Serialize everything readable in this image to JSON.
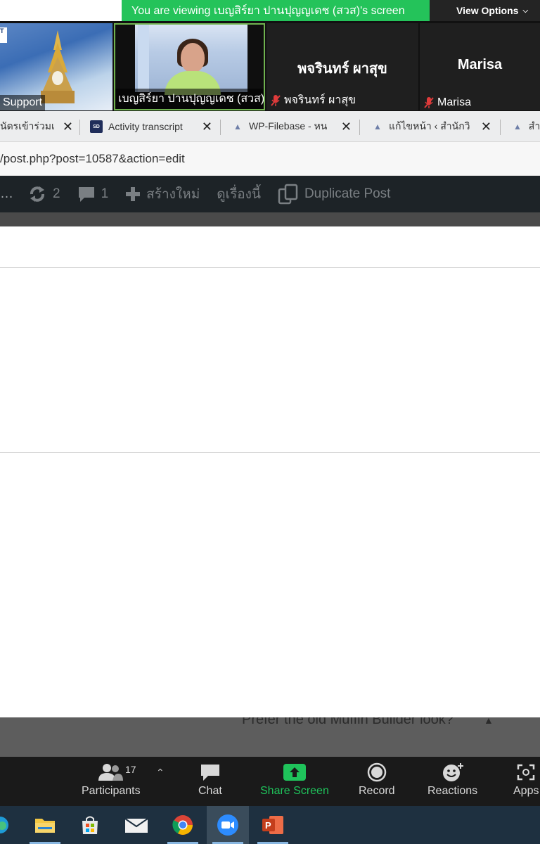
{
  "zoom": {
    "banner_text": "You are viewing เบญสิร์ยา ปานปุญญเดช (สวส)'s screen",
    "view_options": "View Options",
    "participants": [
      {
        "label": "Support"
      },
      {
        "label": "เบญสิร์ยา ปานปุญญเดช (สวส)"
      },
      {
        "name": "พจรินทร์ ผาสุข",
        "label": "พจรินทร์ ผาสุข"
      },
      {
        "name": "Marisa",
        "label": "Marisa"
      }
    ],
    "logo_fragment": "T",
    "controls": {
      "participants": "Participants",
      "participants_count": "17",
      "chat": "Chat",
      "share_screen": "Share Screen",
      "record": "Record",
      "reactions": "Reactions",
      "apps": "Apps"
    },
    "colors": {
      "share_green": "#1fc35b",
      "banner_green": "#24c35a"
    }
  },
  "browser": {
    "tabs": [
      {
        "title": "นัดรเข้าร่วมเ",
        "icon": "none"
      },
      {
        "title": "Activity transcript",
        "icon": "sd-icon",
        "icon_text": "SD"
      },
      {
        "title": "WP-Filebase - หน",
        "icon": "site-icon"
      },
      {
        "title": "แก้ไขหน้า ‹ สำนักวิ",
        "icon": "site-icon"
      },
      {
        "title": "สำ",
        "icon": "site-icon"
      }
    ],
    "url": "/post.php?post=10587&action=edit"
  },
  "wp_admin_bar": {
    "ellipsis": "…",
    "updates_count": "2",
    "comments_count": "1",
    "new_label": "สร้างใหม่",
    "view_label": "ดูเรื่องนี้",
    "duplicate_label": "Duplicate Post"
  },
  "behind_text": "Prefer the old Muffin Builder look?",
  "taskbar": {
    "apps": [
      "edge-icon",
      "file-explorer-icon",
      "store-icon",
      "mail-icon",
      "chrome-icon",
      "zoom-icon",
      "powerpoint-icon"
    ]
  }
}
